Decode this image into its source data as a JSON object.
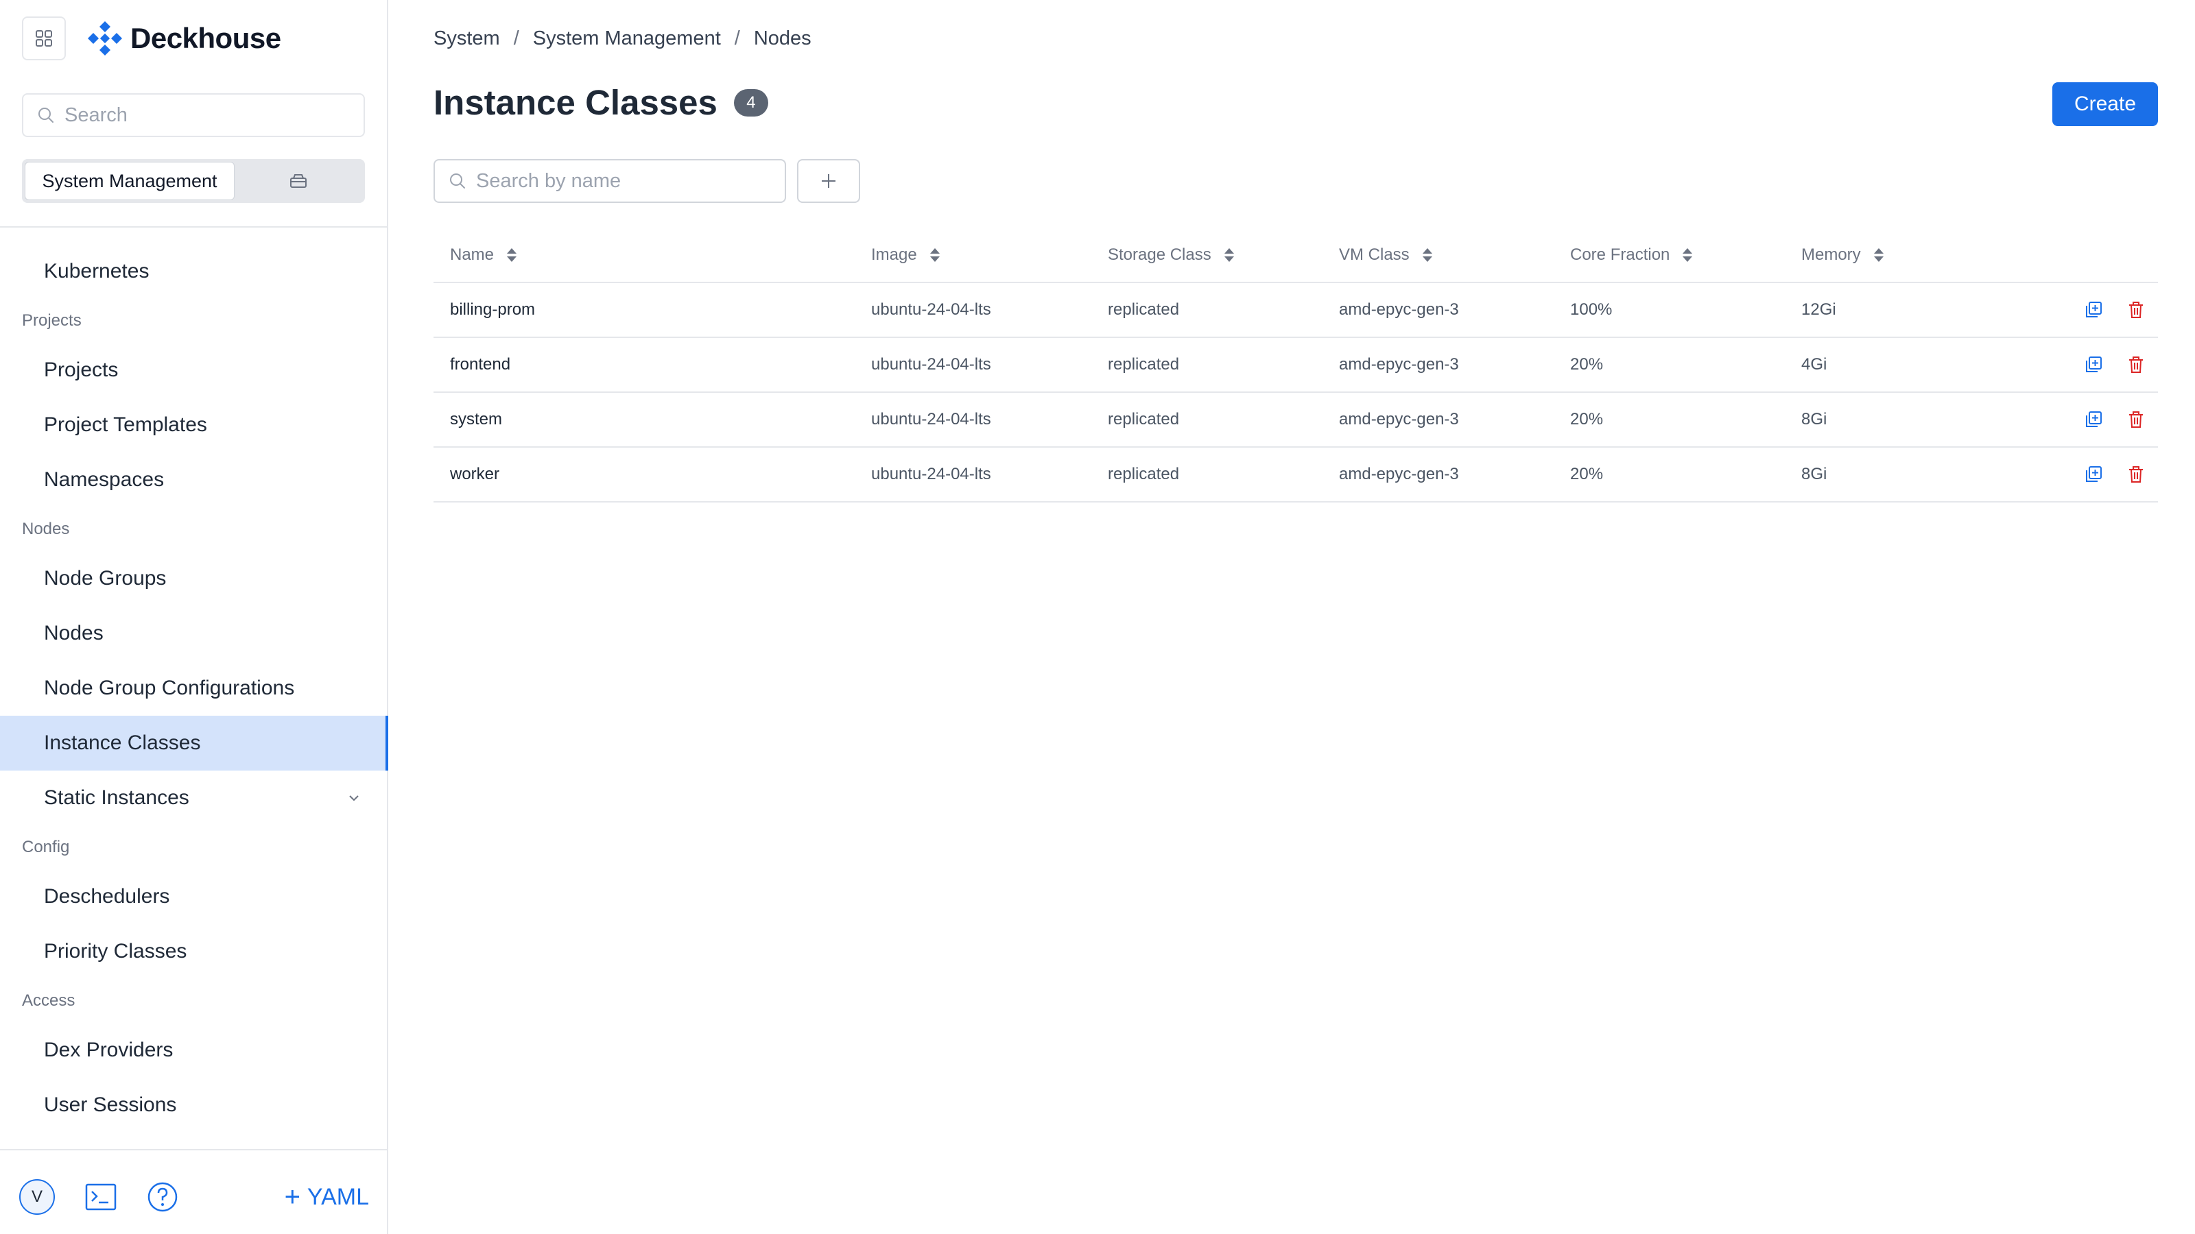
{
  "app": {
    "brand": "Deckhouse",
    "accent_color": "#1a6fe8",
    "danger_color": "#dc2626"
  },
  "sidebar": {
    "search_placeholder": "Search",
    "segment_active": "System Management",
    "segment_other_icon": "archive-icon",
    "nav": [
      {
        "type": "item",
        "label": "Kubernetes"
      },
      {
        "type": "section",
        "label": "Projects"
      },
      {
        "type": "item",
        "label": "Projects"
      },
      {
        "type": "item",
        "label": "Project Templates"
      },
      {
        "type": "item",
        "label": "Namespaces"
      },
      {
        "type": "section",
        "label": "Nodes"
      },
      {
        "type": "item",
        "label": "Node Groups"
      },
      {
        "type": "item",
        "label": "Nodes"
      },
      {
        "type": "item",
        "label": "Node Group Configurations"
      },
      {
        "type": "item",
        "label": "Instance Classes",
        "active": true
      },
      {
        "type": "item",
        "label": "Static Instances",
        "expandable": true
      },
      {
        "type": "section",
        "label": "Config"
      },
      {
        "type": "item",
        "label": "Deschedulers"
      },
      {
        "type": "item",
        "label": "Priority Classes"
      },
      {
        "type": "section",
        "label": "Access"
      },
      {
        "type": "item",
        "label": "Dex Providers"
      },
      {
        "type": "item",
        "label": "User Sessions"
      }
    ],
    "bottom": {
      "avatar_letter": "V",
      "yaml_label": "YAML"
    }
  },
  "breadcrumb": [
    "System",
    "System Management",
    "Nodes"
  ],
  "page": {
    "title": "Instance Classes",
    "count": "4",
    "create_label": "Create",
    "search_placeholder": "Search by name"
  },
  "table": {
    "columns": [
      "Name",
      "Image",
      "Storage Class",
      "VM Class",
      "Core Fraction",
      "Memory"
    ],
    "rows": [
      [
        "billing-prom",
        "ubuntu-24-04-lts",
        "replicated",
        "amd-epyc-gen-3",
        "100%",
        "12Gi"
      ],
      [
        "frontend",
        "ubuntu-24-04-lts",
        "replicated",
        "amd-epyc-gen-3",
        "20%",
        "4Gi"
      ],
      [
        "system",
        "ubuntu-24-04-lts",
        "replicated",
        "amd-epyc-gen-3",
        "20%",
        "8Gi"
      ],
      [
        "worker",
        "ubuntu-24-04-lts",
        "replicated",
        "amd-epyc-gen-3",
        "20%",
        "8Gi"
      ]
    ]
  }
}
